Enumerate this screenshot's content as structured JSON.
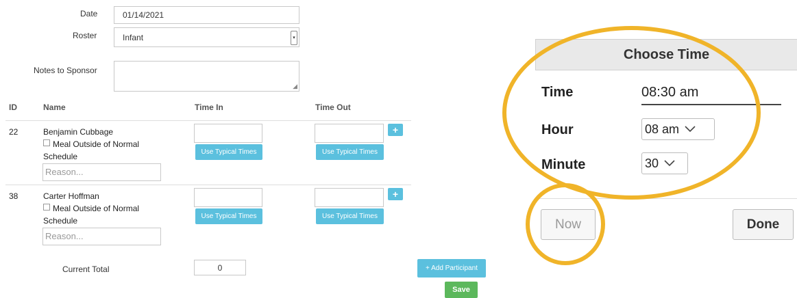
{
  "form": {
    "date_label": "Date",
    "date_value": "01/14/2021",
    "roster_label": "Roster",
    "roster_value": "Infant",
    "notes_label": "Notes to Sponsor",
    "notes_value": ""
  },
  "table": {
    "headers": [
      "ID",
      "Name",
      "Time In",
      "Time Out"
    ],
    "rows": [
      {
        "id": "22",
        "name": "Benjamin Cubbage",
        "meal_line1": "Meal Outside of Normal",
        "meal_line2": "Schedule",
        "reason_placeholder": "Reason...",
        "typical_in": "Use Typical Times",
        "typical_out": "Use Typical Times",
        "plus": "+"
      },
      {
        "id": "38",
        "name": "Carter Hoffman",
        "meal_line1": "Meal Outside of Normal",
        "meal_line2": "Schedule",
        "reason_placeholder": "Reason...",
        "typical_in": "Use Typical Times",
        "typical_out": "Use Typical Times",
        "plus": "+"
      }
    ]
  },
  "footer": {
    "current_total_label": "Current Total",
    "current_total_value": "0",
    "add_participant": "+ Add Participant",
    "save": "Save"
  },
  "time_picker": {
    "title": "Choose Time",
    "time_label": "Time",
    "time_value": "08:30 am",
    "hour_label": "Hour",
    "hour_value": "08 am",
    "minute_label": "Minute",
    "minute_value": "30",
    "now_button": "Now",
    "done_button": "Done"
  },
  "colors": {
    "accent_blue": "#5bc0de",
    "save_green": "#5cb85c",
    "highlight_circle": "#f0b429"
  }
}
